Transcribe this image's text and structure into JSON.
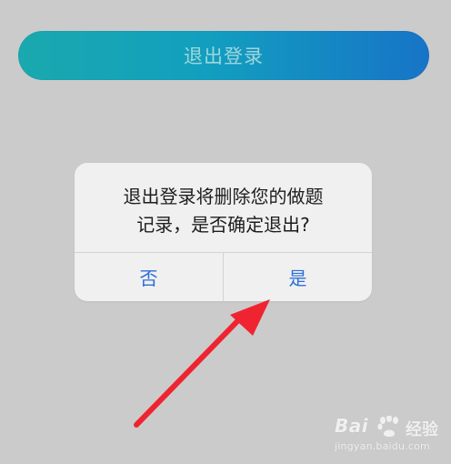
{
  "header": {
    "logout_label": "退出登录"
  },
  "dialog": {
    "message_line1": "退出登录将删除您的做题",
    "message_line2": "记录，是否确定退出?",
    "no_label": "否",
    "yes_label": "是"
  },
  "watermark": {
    "brand": "Bai",
    "product": "经验",
    "url": "jingyan.baidu.com"
  },
  "colors": {
    "background": "#cbcbcb",
    "dialog_button": "#2b6fd9",
    "arrow": "#ef2430"
  },
  "icons": {
    "annotation": "red-arrow-icon",
    "watermark": "paw-icon"
  }
}
